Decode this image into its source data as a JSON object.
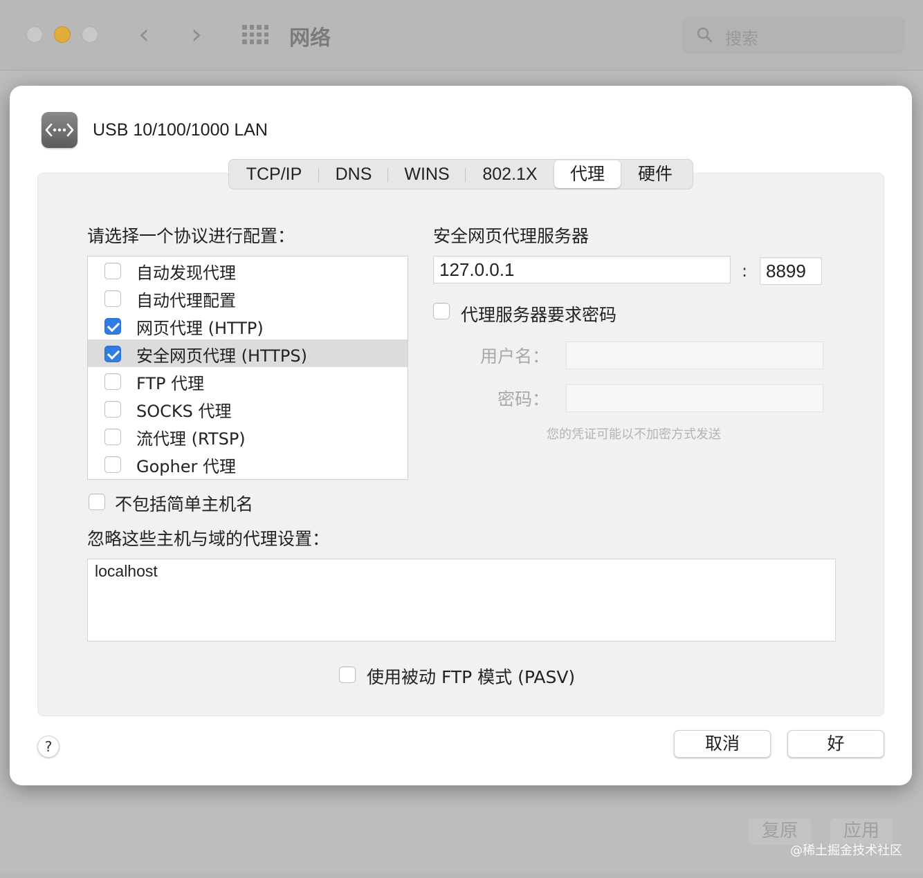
{
  "window": {
    "title": "网络",
    "search_placeholder": "搜索",
    "revert_label": "复原",
    "apply_label": "应用"
  },
  "watermark": "@稀土掘金技术社区",
  "interface": {
    "name": "USB 10/100/1000 LAN"
  },
  "tabs": [
    {
      "label": "TCP/IP",
      "active": false
    },
    {
      "label": "DNS",
      "active": false
    },
    {
      "label": "WINS",
      "active": false
    },
    {
      "label": "802.1X",
      "active": false
    },
    {
      "label": "代理",
      "active": true
    },
    {
      "label": "硬件",
      "active": false
    }
  ],
  "protocols": {
    "title": "请选择一个协议进行配置：",
    "items": [
      {
        "label": "自动发现代理",
        "checked": false,
        "selected": false
      },
      {
        "label": "自动代理配置",
        "checked": false,
        "selected": false
      },
      {
        "label": "网页代理 (HTTP)",
        "checked": true,
        "selected": false
      },
      {
        "label": "安全网页代理 (HTTPS)",
        "checked": true,
        "selected": true
      },
      {
        "label": "FTP 代理",
        "checked": false,
        "selected": false
      },
      {
        "label": "SOCKS 代理",
        "checked": false,
        "selected": false
      },
      {
        "label": "流代理 (RTSP)",
        "checked": false,
        "selected": false
      },
      {
        "label": "Gopher 代理",
        "checked": false,
        "selected": false
      }
    ]
  },
  "server": {
    "title": "安全网页代理服务器",
    "address": "127.0.0.1",
    "separator": ":",
    "port": "8899",
    "requires_password_label": "代理服务器要求密码",
    "requires_password": false,
    "username_label": "用户名：",
    "password_label": "密码：",
    "note": "您的凭证可能以不加密方式发送"
  },
  "exclude_simple_label": "不包括简单主机名",
  "bypass": {
    "title": "忽略这些主机与域的代理设置：",
    "value": "localhost"
  },
  "pasv_label": "使用被动 FTP 模式 (PASV)",
  "buttons": {
    "help": "?",
    "cancel": "取消",
    "ok": "好"
  },
  "colors": {
    "accent": "#2f7de1",
    "minimize": "#e2ad3b"
  }
}
